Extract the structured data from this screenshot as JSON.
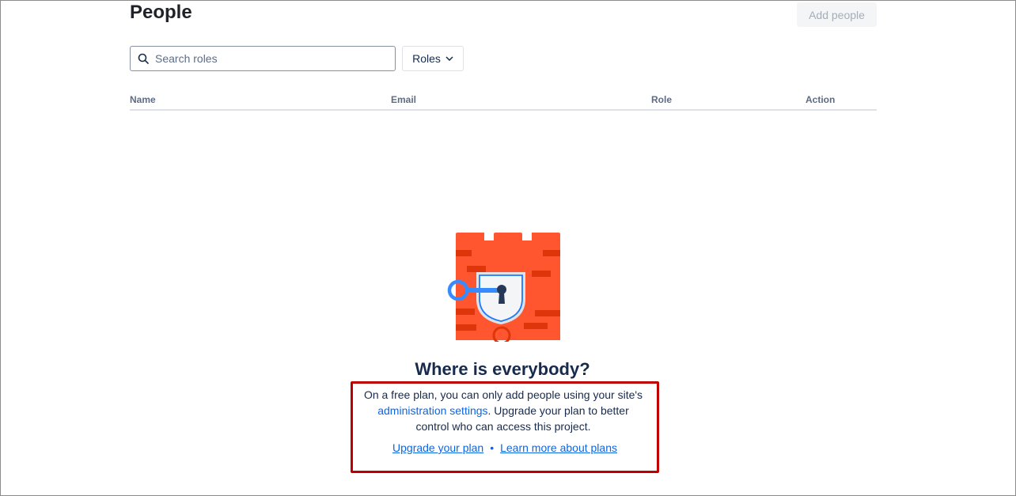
{
  "header": {
    "title": "People",
    "add_button_label": "Add people"
  },
  "filters": {
    "search_placeholder": "Search roles",
    "search_value": "",
    "roles_label": "Roles"
  },
  "table": {
    "columns": [
      "Name",
      "Email",
      "Role",
      "Action"
    ]
  },
  "empty_state": {
    "title": "Where is everybody?",
    "desc_before": "On a free plan, you can only add people using your site's ",
    "desc_link": "administration settings",
    "desc_after": ". Upgrade your plan to better control who can access this project.",
    "upgrade_link": "Upgrade your plan",
    "separator": "•",
    "learn_link": "Learn more about plans"
  },
  "colors": {
    "accent": "#0c66e4",
    "highlight_border": "#c00000",
    "castle": "#ff5630"
  }
}
